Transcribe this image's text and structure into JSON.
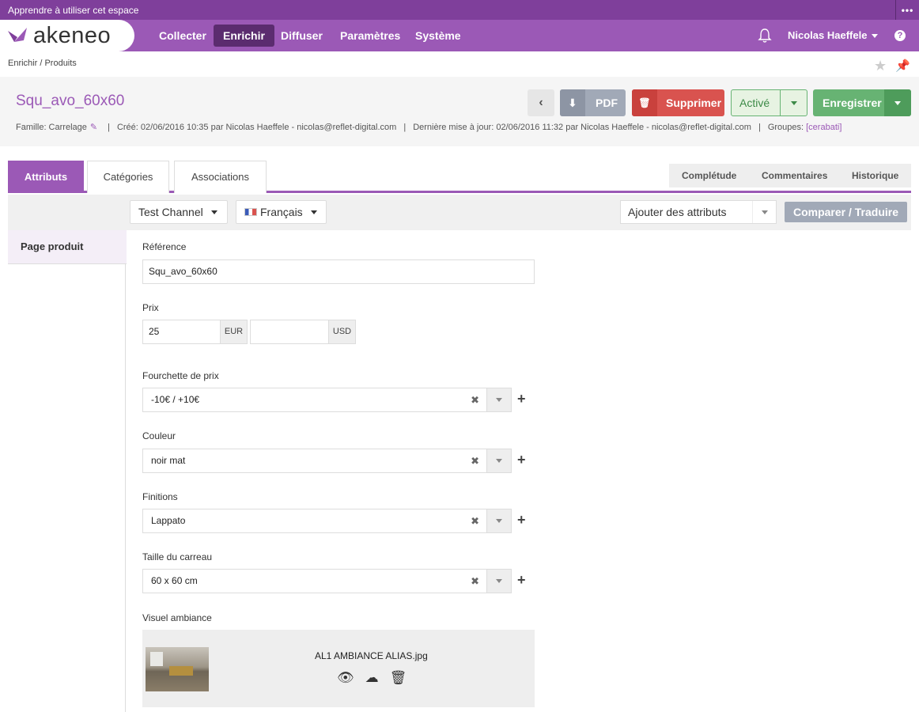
{
  "topbar": {
    "learn": "Apprendre à utiliser cet espace",
    "dots": "•••"
  },
  "nav": {
    "brand": "akeneo",
    "items": [
      "Collecter",
      "Enrichir",
      "Diffuser",
      "Paramètres",
      "Système"
    ],
    "active_item": "Enrichir",
    "user": "Nicolas Haeffele",
    "help": "?"
  },
  "breadcrumb": "Enrichir / Produits",
  "product": {
    "title": "Squ_avo_60x60",
    "family": "Famille: Carrelage",
    "created": "Créé: 02/06/2016 10:35 par Nicolas Haeffele - nicolas@reflet-digital.com",
    "updated": "Dernière mise à jour: 02/06/2016 11:32 par Nicolas Haeffele - nicolas@reflet-digital.com",
    "groups_label": "Groupes:",
    "groups_value": "[cerabati]"
  },
  "buttons": {
    "back": "‹",
    "pdf": "PDF",
    "delete": "Supprimer",
    "status": "Activé",
    "save": "Enregistrer"
  },
  "tabs": [
    "Attributs",
    "Catégories",
    "Associations"
  ],
  "right_tabs": [
    "Complétude",
    "Commentaires",
    "Historique"
  ],
  "toolbar": {
    "channel": "Test Channel",
    "locale": "Français",
    "add_attributes": "Ajouter des attributs",
    "compare": "Comparer / Traduire"
  },
  "sidebar": {
    "groups": [
      "Page produit"
    ]
  },
  "form": {
    "reference": {
      "label": "Référence",
      "value": "Squ_avo_60x60"
    },
    "price": {
      "label": "Prix",
      "eur_value": "25",
      "eur_unit": "EUR",
      "usd_value": "",
      "usd_unit": "USD"
    },
    "price_range": {
      "label": "Fourchette de prix",
      "value": "-10€ / +10€"
    },
    "color": {
      "label": "Couleur",
      "value": "noir mat"
    },
    "finish": {
      "label": "Finitions",
      "value": "Lappato"
    },
    "tile_size": {
      "label": "Taille du carreau",
      "value": "60 x 60 cm"
    },
    "visual": {
      "label": "Visuel ambiance",
      "filename": "AL1 AMBIANCE ALIAS.jpg"
    }
  },
  "icons": {
    "bell": "bell-icon",
    "star": "star-icon",
    "pin": "pin-icon",
    "download": "download-icon",
    "trash": "trash-icon",
    "pencil": "pencil-icon",
    "eye": "eye-icon",
    "cloud": "cloud-download-icon",
    "plus": "plus-icon"
  },
  "colors": {
    "brand": "#9b59b6",
    "brand_dark": "#5b2c6f",
    "danger": "#d9534f",
    "success": "#67b373",
    "neutral": "#a1a9b7"
  }
}
